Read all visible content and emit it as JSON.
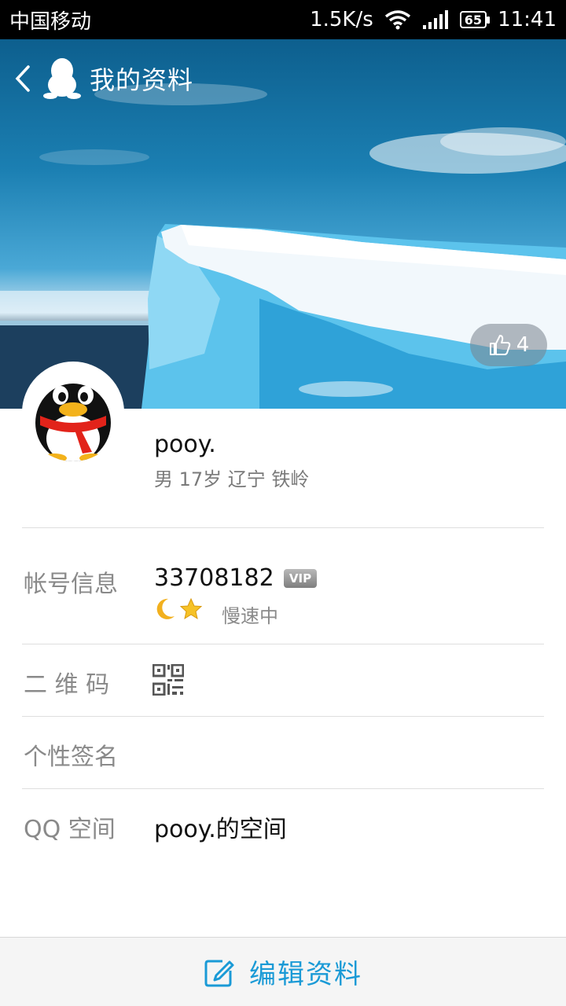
{
  "status_bar": {
    "carrier": "中国移动",
    "speed": "1.5K/s",
    "battery": "65",
    "time": "11:41"
  },
  "nav": {
    "title": "我的资料"
  },
  "likes": {
    "count": "4"
  },
  "profile": {
    "name": "pooy.",
    "info": "男 17岁 辽宁 铁岭"
  },
  "rows": {
    "account": {
      "label": "帐号信息",
      "number": "33708182",
      "vip": "VIP",
      "status": "慢速中"
    },
    "qrcode": {
      "label": "二 维 码"
    },
    "signature": {
      "label": "个性签名"
    },
    "qzone": {
      "label": "QQ 空间",
      "value": "pooy.的空间"
    }
  },
  "bottom": {
    "edit_label": "编辑资料"
  },
  "colors": {
    "accent": "#1a9ad6",
    "label_gray": "#8a8a8a"
  }
}
